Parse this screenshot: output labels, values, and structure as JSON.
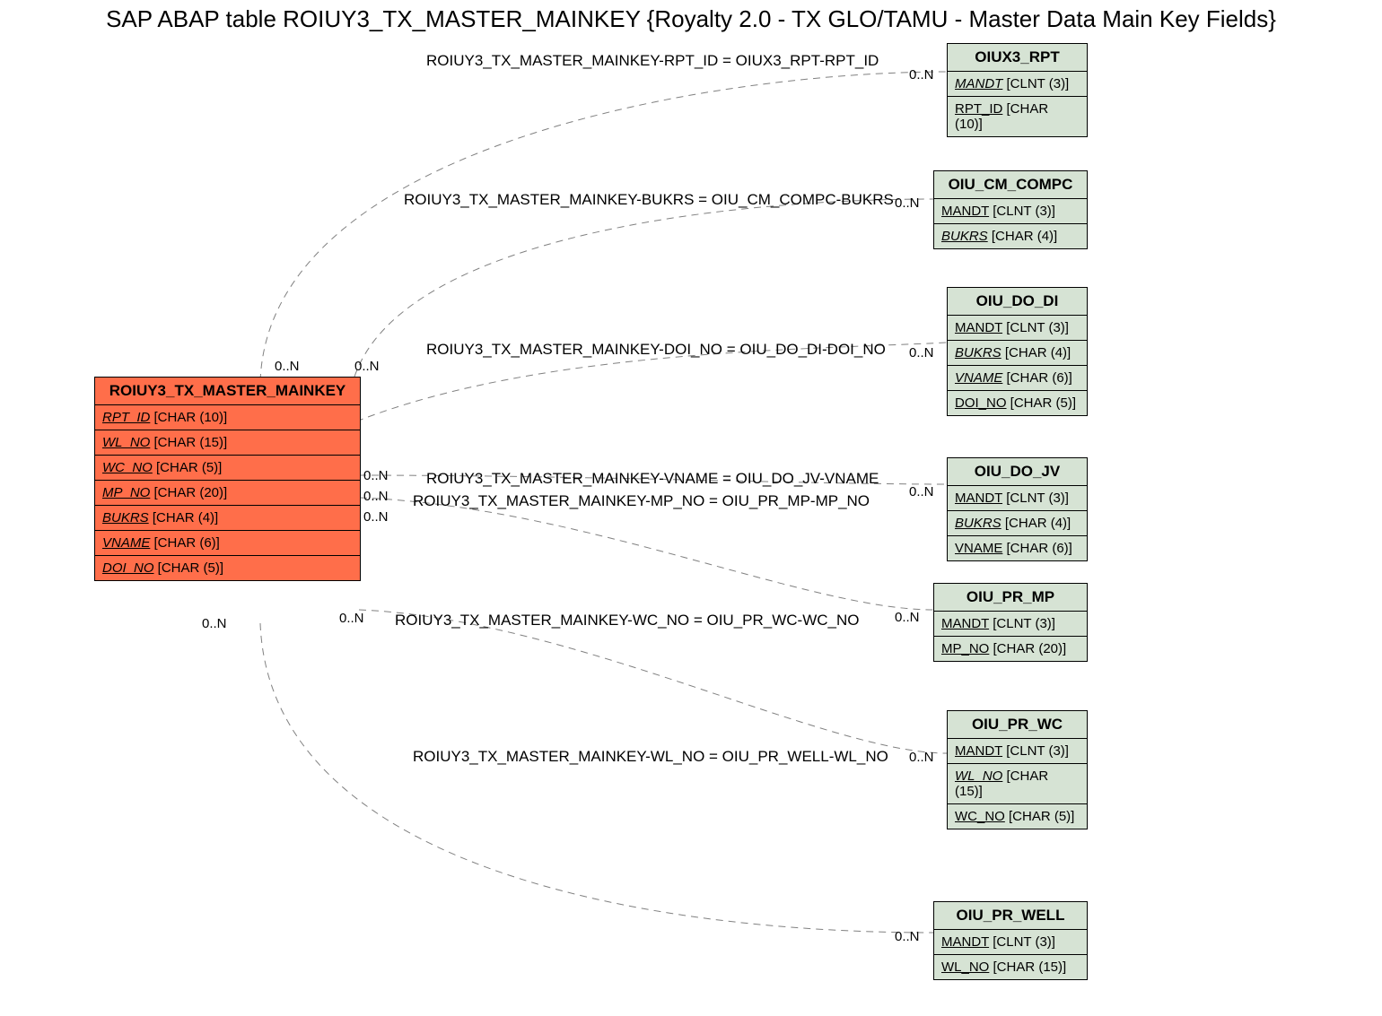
{
  "title": "SAP ABAP table ROIUY3_TX_MASTER_MAINKEY {Royalty 2.0 - TX GLO/TAMU - Master Data Main Key Fields}",
  "main_table": {
    "name": "ROIUY3_TX_MASTER_MAINKEY",
    "fields": [
      {
        "name": "RPT_ID",
        "type": "[CHAR (10)]",
        "italic": true
      },
      {
        "name": "WL_NO",
        "type": "[CHAR (15)]",
        "italic": true
      },
      {
        "name": "WC_NO",
        "type": "[CHAR (5)]",
        "italic": true
      },
      {
        "name": "MP_NO",
        "type": "[CHAR (20)]",
        "italic": true
      },
      {
        "name": "BUKRS",
        "type": "[CHAR (4)]",
        "italic": true
      },
      {
        "name": "VNAME",
        "type": "[CHAR (6)]",
        "italic": true
      },
      {
        "name": "DOI_NO",
        "type": "[CHAR (5)]",
        "italic": true
      }
    ]
  },
  "related_tables": [
    {
      "name": "OIUX3_RPT",
      "fields": [
        {
          "name": "MANDT",
          "type": "[CLNT (3)]",
          "italic": true
        },
        {
          "name": "RPT_ID",
          "type": "[CHAR (10)]",
          "italic": false
        }
      ]
    },
    {
      "name": "OIU_CM_COMPC",
      "fields": [
        {
          "name": "MANDT",
          "type": "[CLNT (3)]",
          "italic": false
        },
        {
          "name": "BUKRS",
          "type": "[CHAR (4)]",
          "italic": true
        }
      ]
    },
    {
      "name": "OIU_DO_DI",
      "fields": [
        {
          "name": "MANDT",
          "type": "[CLNT (3)]",
          "italic": false
        },
        {
          "name": "BUKRS",
          "type": "[CHAR (4)]",
          "italic": true
        },
        {
          "name": "VNAME",
          "type": "[CHAR (6)]",
          "italic": true
        },
        {
          "name": "DOI_NO",
          "type": "[CHAR (5)]",
          "italic": false
        }
      ]
    },
    {
      "name": "OIU_DO_JV",
      "fields": [
        {
          "name": "MANDT",
          "type": "[CLNT (3)]",
          "italic": false
        },
        {
          "name": "BUKRS",
          "type": "[CHAR (4)]",
          "italic": true
        },
        {
          "name": "VNAME",
          "type": "[CHAR (6)]",
          "italic": false
        }
      ]
    },
    {
      "name": "OIU_PR_MP",
      "fields": [
        {
          "name": "MANDT",
          "type": "[CLNT (3)]",
          "italic": false
        },
        {
          "name": "MP_NO",
          "type": "[CHAR (20)]",
          "italic": false
        }
      ]
    },
    {
      "name": "OIU_PR_WC",
      "fields": [
        {
          "name": "MANDT",
          "type": "[CLNT (3)]",
          "italic": false
        },
        {
          "name": "WL_NO",
          "type": "[CHAR (15)]",
          "italic": true
        },
        {
          "name": "WC_NO",
          "type": "[CHAR (5)]",
          "italic": false
        }
      ]
    },
    {
      "name": "OIU_PR_WELL",
      "fields": [
        {
          "name": "MANDT",
          "type": "[CLNT (3)]",
          "italic": false
        },
        {
          "name": "WL_NO",
          "type": "[CHAR (15)]",
          "italic": false
        }
      ]
    }
  ],
  "relations": [
    "ROIUY3_TX_MASTER_MAINKEY-RPT_ID = OIUX3_RPT-RPT_ID",
    "ROIUY3_TX_MASTER_MAINKEY-BUKRS = OIU_CM_COMPC-BUKRS",
    "ROIUY3_TX_MASTER_MAINKEY-DOI_NO = OIU_DO_DI-DOI_NO",
    "ROIUY3_TX_MASTER_MAINKEY-VNAME = OIU_DO_JV-VNAME",
    "ROIUY3_TX_MASTER_MAINKEY-MP_NO = OIU_PR_MP-MP_NO",
    "ROIUY3_TX_MASTER_MAINKEY-WC_NO = OIU_PR_WC-WC_NO",
    "ROIUY3_TX_MASTER_MAINKEY-WL_NO = OIU_PR_WELL-WL_NO"
  ],
  "cardinality": "0..N"
}
